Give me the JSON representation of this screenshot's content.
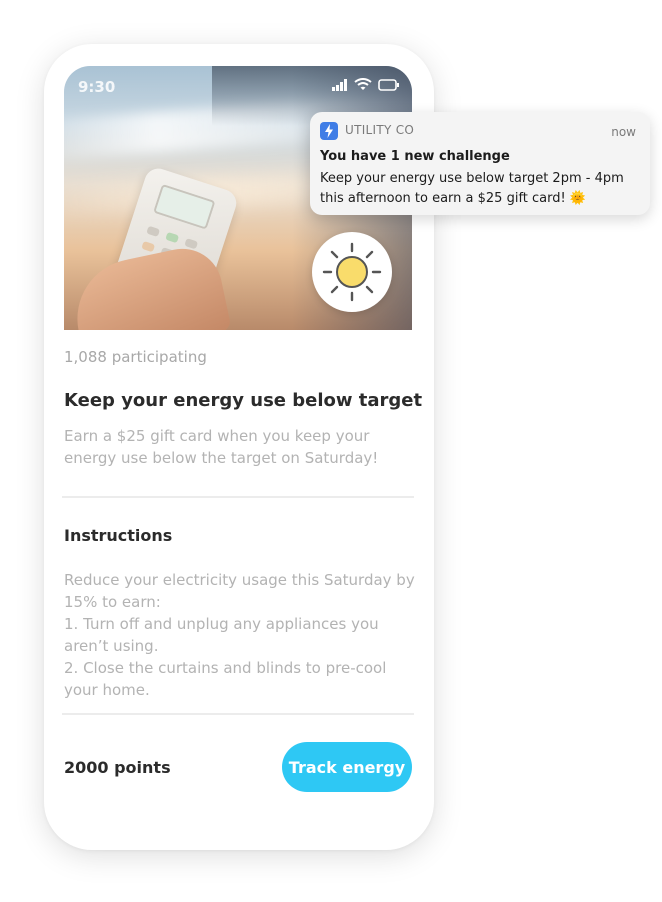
{
  "status_bar": {
    "time": "9:30"
  },
  "notification": {
    "app_name": "UTILITY CO",
    "time": "now",
    "title": "You have 1 new challenge",
    "body": "Keep your energy use below target 2pm - 4pm this afternoon to earn a $25 gift card! 🌞"
  },
  "challenge": {
    "participants": "1,088 participating",
    "title": "Keep your energy use below target",
    "description": "Earn a $25 gift card when you keep your energy use below the target on Saturday!",
    "instructions_heading": "Instructions",
    "instructions_lines": [
      "Reduce your electricity usage this Saturday by",
      "15% to earn:",
      "1. Turn off and unplug any appliances you",
      "aren’t using.",
      "2. Close the curtains and blinds to pre-cool",
      "your home."
    ]
  },
  "footer": {
    "points": "2000 points",
    "track_button": "Track energy"
  },
  "colors": {
    "accent": "#2ec8f4",
    "app_icon": "#3f7de6",
    "sun": "#f9dc6b"
  },
  "icons": [
    "signal-icon",
    "wifi-icon",
    "battery-icon",
    "sun-icon",
    "lightning-icon"
  ]
}
